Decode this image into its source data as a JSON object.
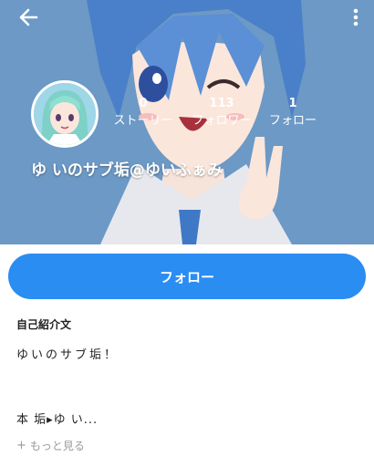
{
  "header": {
    "back_icon": "back-arrow-icon",
    "more_icon": "more-vertical-icon",
    "colors": {
      "background": "#2f6fad",
      "text": "#ffffff"
    }
  },
  "profile": {
    "username": "ゆ いのサブ垢@ゆいふぁみ",
    "stats": [
      {
        "count": "0",
        "label": "ストーリー"
      },
      {
        "count": "113",
        "label": "フォロワー"
      },
      {
        "count": "1",
        "label": "フォロー"
      }
    ]
  },
  "actions": {
    "follow_label": "フォロー",
    "accent": "#2a8df2"
  },
  "bio": {
    "heading": "自己紹介文",
    "line1": "ゆいのサブ垢！",
    "line2": "本 垢▸ゆ い...",
    "more_label": "もっと見る"
  }
}
